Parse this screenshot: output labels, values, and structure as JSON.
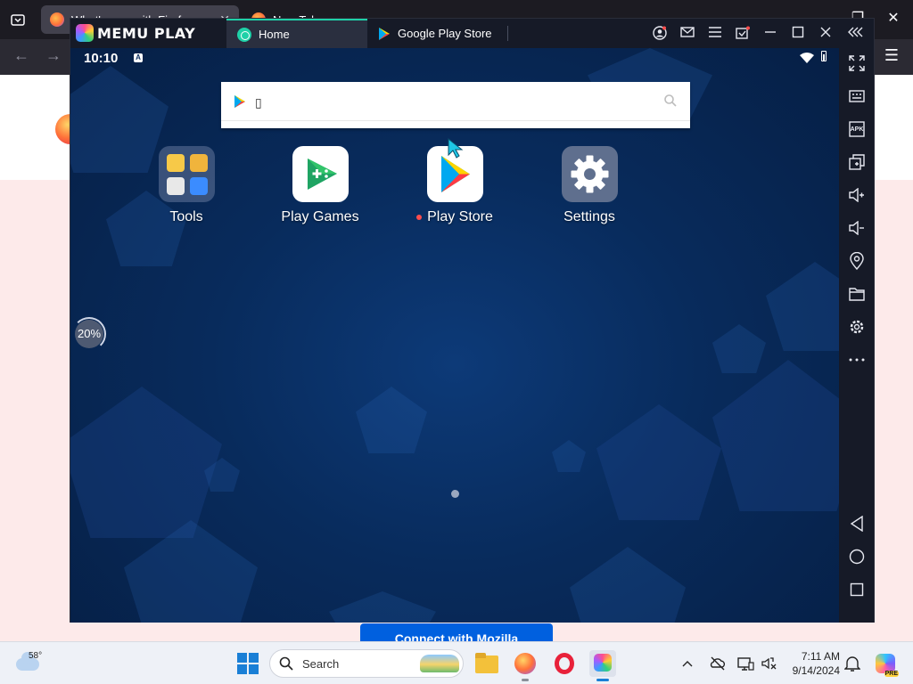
{
  "firefox": {
    "tab_active_title": "What's new with Firefox",
    "tab_new_title": "New Tab",
    "tab_close": "✕",
    "connect_button": "Connect with Mozilla"
  },
  "memu": {
    "logo_text": "MEMU PLAY",
    "tabs": [
      {
        "label": "Home"
      },
      {
        "label": "Google Play Store"
      }
    ]
  },
  "android": {
    "time": "10:10",
    "status_badge": "A",
    "search": {
      "placeholder": "",
      "value": "▯"
    },
    "apps": [
      {
        "label": "Tools"
      },
      {
        "label": "Play Games"
      },
      {
        "label": "Play Store",
        "has_new_indicator": true
      },
      {
        "label": "Settings"
      }
    ],
    "progress_percent": 20,
    "progress_text": "20%"
  },
  "sidebar": {
    "icons": [
      "fullscreen-icon",
      "keyboard-icon",
      "apk-icon",
      "multi-instance-icon",
      "volume-up-icon",
      "volume-down-icon",
      "location-icon",
      "folder-icon",
      "settings-icon",
      "more-icon",
      "back-icon",
      "home-icon",
      "recents-icon"
    ],
    "apk_label": "APK"
  },
  "taskbar": {
    "temperature": "58°",
    "search_label": "Search",
    "time": "7:11 AM",
    "date": "9/14/2024",
    "copilot_badge": "PRE"
  },
  "colors": {
    "memu_titlebar": "#161a27",
    "home_tab_accent": "#1fd1a8",
    "android_bg": "#082b5c",
    "taskbar_bg": "#eef1f7",
    "firefox_blue": "#0060df"
  }
}
